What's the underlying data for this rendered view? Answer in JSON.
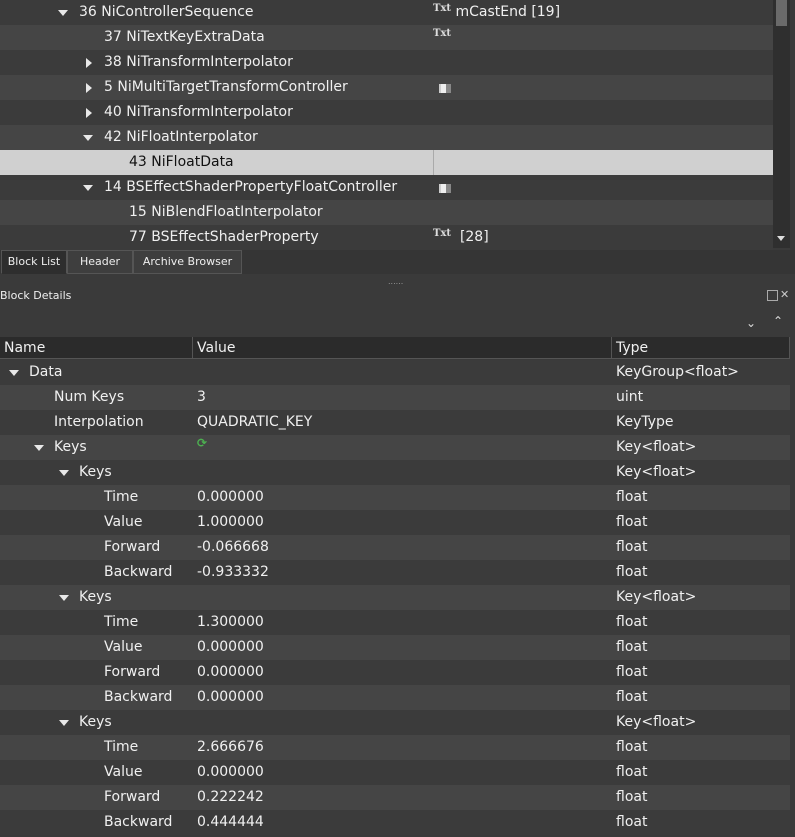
{
  "block_tree": {
    "rows": [
      {
        "label": "36 NiControllerSequence",
        "value_icon": "txt",
        "value": "mCastEnd [19]",
        "expander": "down"
      },
      {
        "label": "37 NiTextKeyExtraData",
        "value_icon": "txt",
        "value": "",
        "expander": "none"
      },
      {
        "label": "38 NiTransformInterpolator",
        "value_icon": "",
        "value": "",
        "expander": "right"
      },
      {
        "label": "5 NiMultiTargetTransformController",
        "value_icon": "flag",
        "value": "",
        "expander": "right"
      },
      {
        "label": "40 NiTransformInterpolator",
        "value_icon": "",
        "value": "",
        "expander": "right"
      },
      {
        "label": "42 NiFloatInterpolator",
        "value_icon": "",
        "value": "",
        "expander": "down"
      },
      {
        "label": "43 NiFloatData",
        "value_icon": "",
        "value": "",
        "expander": "none"
      },
      {
        "label": "14 BSEffectShaderPropertyFloatController",
        "value_icon": "flag",
        "value": "",
        "expander": "down"
      },
      {
        "label": "15 NiBlendFloatInterpolator",
        "value_icon": "",
        "value": "",
        "expander": "none"
      },
      {
        "label": "77 BSEffectShaderProperty",
        "value_icon": "txt",
        "value": "[28]",
        "expander": "none"
      }
    ],
    "selected_index": 6
  },
  "tabs": {
    "block_list": "Block List",
    "header": "Header",
    "archive_browser": "Archive Browser"
  },
  "grip": "......",
  "dock": {
    "title": "Block Details"
  },
  "details": {
    "columns": {
      "name": "Name",
      "value": "Value",
      "type": "Type"
    },
    "rows": [
      {
        "name": "Data",
        "value": "",
        "type": "KeyGroup<float>"
      },
      {
        "name": "Num Keys",
        "value": "3",
        "type": "uint"
      },
      {
        "name": "Interpolation",
        "value": "QUADRATIC_KEY",
        "type": "KeyType"
      },
      {
        "name": "Keys",
        "value": "",
        "type": "Key<float>"
      },
      {
        "name": "Keys",
        "value": "",
        "type": "Key<float>"
      },
      {
        "name": "Time",
        "value": "0.000000",
        "type": "float"
      },
      {
        "name": "Value",
        "value": "1.000000",
        "type": "float"
      },
      {
        "name": "Forward",
        "value": "-0.066668",
        "type": "float"
      },
      {
        "name": "Backward",
        "value": "-0.933332",
        "type": "float"
      },
      {
        "name": "Keys",
        "value": "",
        "type": "Key<float>"
      },
      {
        "name": "Time",
        "value": "1.300000",
        "type": "float"
      },
      {
        "name": "Value",
        "value": "0.000000",
        "type": "float"
      },
      {
        "name": "Forward",
        "value": "0.000000",
        "type": "float"
      },
      {
        "name": "Backward",
        "value": "0.000000",
        "type": "float"
      },
      {
        "name": "Keys",
        "value": "",
        "type": "Key<float>"
      },
      {
        "name": "Time",
        "value": "2.666676",
        "type": "float"
      },
      {
        "name": "Value",
        "value": "0.000000",
        "type": "float"
      },
      {
        "name": "Forward",
        "value": "0.222242",
        "type": "float"
      },
      {
        "name": "Backward",
        "value": "0.444444",
        "type": "float"
      }
    ]
  }
}
